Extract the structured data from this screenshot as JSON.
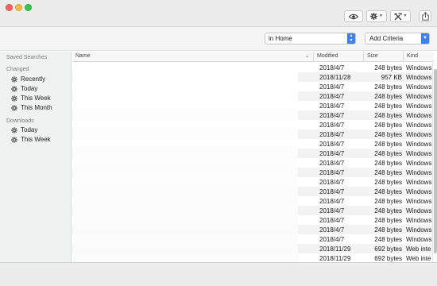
{
  "toolbar": {
    "quicklook_icon": "eye-icon",
    "action_icon": "gear-icon",
    "arrange_icon": "tools-icon",
    "share_icon": "share-icon"
  },
  "search": {
    "scope": "in Home",
    "add_criteria": "Add Criteria"
  },
  "sidebar": {
    "saved_searches_label": "Saved Searches",
    "changed_label": "Changed",
    "changed_items": [
      {
        "label": "Recently",
        "icon": "gear-icon"
      },
      {
        "label": "Today",
        "icon": "gear-icon"
      },
      {
        "label": "This Week",
        "icon": "gear-icon"
      },
      {
        "label": "This Month",
        "icon": "gear-icon"
      }
    ],
    "downloads_label": "Downloads",
    "downloads_items": [
      {
        "label": "Today",
        "icon": "gear-icon"
      },
      {
        "label": "This Week",
        "icon": "gear-icon"
      }
    ]
  },
  "columns": {
    "name": "Name",
    "modified": "Modified",
    "size": "Size",
    "kind": "Kind"
  },
  "rows": [
    {
      "modified": "2018/4/7",
      "size": "248 bytes",
      "kind": "Windows"
    },
    {
      "modified": "2018/11/28",
      "size": "957 KB",
      "kind": "Windows"
    },
    {
      "modified": "2018/4/7",
      "size": "248 bytes",
      "kind": "Windows"
    },
    {
      "modified": "2018/4/7",
      "size": "248 bytes",
      "kind": "Windows"
    },
    {
      "modified": "2018/4/7",
      "size": "248 bytes",
      "kind": "Windows"
    },
    {
      "modified": "2018/4/7",
      "size": "248 bytes",
      "kind": "Windows"
    },
    {
      "modified": "2018/4/7",
      "size": "248 bytes",
      "kind": "Windows"
    },
    {
      "modified": "2018/4/7",
      "size": "248 bytes",
      "kind": "Windows"
    },
    {
      "modified": "2018/4/7",
      "size": "248 bytes",
      "kind": "Windows"
    },
    {
      "modified": "2018/4/7",
      "size": "248 bytes",
      "kind": "Windows"
    },
    {
      "modified": "2018/4/7",
      "size": "248 bytes",
      "kind": "Windows"
    },
    {
      "modified": "2018/4/7",
      "size": "248 bytes",
      "kind": "Windows"
    },
    {
      "modified": "2018/4/7",
      "size": "248 bytes",
      "kind": "Windows"
    },
    {
      "modified": "2018/4/7",
      "size": "248 bytes",
      "kind": "Windows"
    },
    {
      "modified": "2018/4/7",
      "size": "248 bytes",
      "kind": "Windows"
    },
    {
      "modified": "2018/4/7",
      "size": "248 bytes",
      "kind": "Windows"
    },
    {
      "modified": "2018/4/7",
      "size": "248 bytes",
      "kind": "Windows"
    },
    {
      "modified": "2018/4/7",
      "size": "248 bytes",
      "kind": "Windows"
    },
    {
      "modified": "2018/4/7",
      "size": "248 bytes",
      "kind": "Windows"
    },
    {
      "modified": "2018/11/29",
      "size": "692 bytes",
      "kind": "Web inte"
    },
    {
      "modified": "2018/11/29",
      "size": "692 bytes",
      "kind": "Web inte"
    }
  ],
  "colors": {
    "accent": "#3b82f0",
    "close": "#fc605c",
    "minimize": "#fdbc40",
    "maximize": "#34c84a"
  }
}
